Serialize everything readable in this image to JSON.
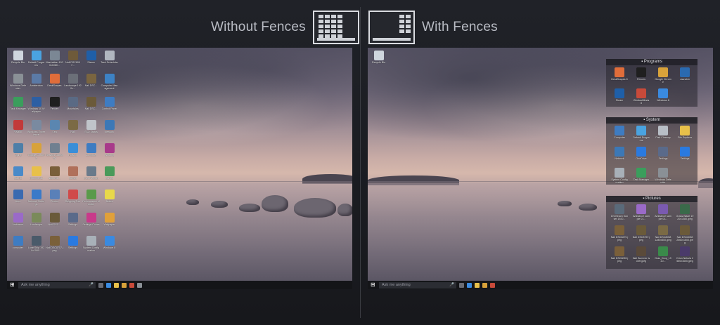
{
  "left": {
    "title": "Without Fences",
    "taskbar": {
      "search": "Ask me anything"
    },
    "icons": [
      {
        "label": "Recycle Bin",
        "color": "#cfd6de"
      },
      {
        "label": "Default Programs",
        "color": "#4aa3e0"
      },
      {
        "label": "Manhattan 1920x1080...",
        "color": "#7b8794"
      },
      {
        "label": "Nail DSC8097...",
        "color": "#6e5a3a"
      },
      {
        "label": "Steam",
        "color": "#1f5fa8"
      },
      {
        "label": "Task Scheduler",
        "color": "#b0b6bf"
      },
      {
        "label": "Windows Defender",
        "color": "#8a9096"
      },
      {
        "label": "Amsterdam",
        "color": "#5b7aa6"
      },
      {
        "label": "DeskScapes",
        "color": "#e06d3a"
      },
      {
        "label": "Landscape 1920x...",
        "color": "#6b6f78"
      },
      {
        "label": "Nail DSC...",
        "color": "#7a6540"
      },
      {
        "label": "Computer Management",
        "color": "#3d82c4"
      },
      {
        "label": "Task Manager",
        "color": "#3a9e5c"
      },
      {
        "label": "Windows 10 Wallpaper",
        "color": "#2d5fa3"
      },
      {
        "label": "Fences",
        "color": "#1f1f1f"
      },
      {
        "label": "Mountains",
        "color": "#5a6a84"
      },
      {
        "label": "Nail DSC...",
        "color": "#6b5a3a"
      },
      {
        "label": "Control Panel",
        "color": "#3e7cc2"
      },
      {
        "label": "Vivaldi",
        "color": "#c23a3a"
      },
      {
        "label": "Windows Experience",
        "color": "#7a8aa0"
      },
      {
        "label": "Sea",
        "color": "#5b86b0"
      },
      {
        "label": "Nail",
        "color": "#7b6a45"
      },
      {
        "label": "SSD Status",
        "color": "#c0c4ca"
      },
      {
        "label": "Network",
        "color": "#3c78b6"
      },
      {
        "label": "Alpine",
        "color": "#4d7fa8"
      },
      {
        "label": "Google Chrome",
        "color": "#d8a23a"
      },
      {
        "label": "Network Gateway",
        "color": "#708090"
      },
      {
        "label": "Hotspot",
        "color": "#3a8ed8"
      },
      {
        "label": "Computer",
        "color": "#3e7cc2"
      },
      {
        "label": "Winamp",
        "color": "#a83a8a"
      },
      {
        "label": "Start10",
        "color": "#4a8ac8"
      },
      {
        "label": "Documents",
        "color": "#e8c04a"
      },
      {
        "label": "Nail DSC...",
        "color": "#7a5f3a"
      },
      {
        "label": "Sunset",
        "color": "#b0705a"
      },
      {
        "label": "Event Viewer",
        "color": "#6a7a8a"
      },
      {
        "label": "Games",
        "color": "#4a9a5a"
      },
      {
        "label": "Aero",
        "color": "#3a6ab0"
      },
      {
        "label": "Network Settings",
        "color": "#3a7ac8"
      },
      {
        "label": "Photos",
        "color": "#5a80b8"
      },
      {
        "label": "Snipping Tool",
        "color": "#d04a4a"
      },
      {
        "label": "Performance Monitor",
        "color": "#5a9a4a"
      },
      {
        "label": "Notes",
        "color": "#e8d84a"
      },
      {
        "label": "Ambiance",
        "color": "#9a6ac8"
      },
      {
        "label": "Landscape",
        "color": "#7a8a5a"
      },
      {
        "label": "Nail DSC...",
        "color": "#6a5a3a"
      },
      {
        "label": "Settings",
        "color": "#5a6a8a"
      },
      {
        "label": "Settings Colors",
        "color": "#c83a8a"
      },
      {
        "label": "Wallpaper",
        "color": "#e0a03a"
      },
      {
        "label": "computer",
        "color": "#3e7cc2"
      },
      {
        "label": "Lone Ship 1920x1080...",
        "color": "#4a5a6a"
      },
      {
        "label": "Nail DSC8757.jpeg",
        "color": "#7a603a"
      },
      {
        "label": "Settings",
        "color": "#2a7ae0"
      },
      {
        "label": "System Configuration",
        "color": "#a8b0b8"
      },
      {
        "label": "Windows 8",
        "color": "#3a8ae0"
      }
    ]
  },
  "right": {
    "title": "With Fences",
    "taskbar": {
      "search": "Ask me anything"
    },
    "recycle": {
      "label": "Recycle Bin"
    },
    "fences": [
      {
        "name": "Programs",
        "items": [
          {
            "label": "DeskScapes 8",
            "color": "#e06d3a"
          },
          {
            "label": "Fences",
            "color": "#1f1f1f"
          },
          {
            "label": "Google Chrome",
            "color": "#d8a23a"
          },
          {
            "label": "Launcher",
            "color": "#2a6ab0"
          },
          {
            "label": "Steam",
            "color": "#1f5fa8"
          },
          {
            "label": "WindowBlinds 8",
            "color": "#c84a3a"
          },
          {
            "label": "Windows 8",
            "color": "#3a8ae0"
          }
        ]
      },
      {
        "name": "System",
        "items": [
          {
            "label": "Computer",
            "color": "#3e7cc2"
          },
          {
            "label": "Default Programs",
            "color": "#4aa3e0"
          },
          {
            "label": "Disk Cleanup",
            "color": "#b8bec6"
          },
          {
            "label": "File Explorer",
            "color": "#e8c04a"
          },
          {
            "label": "Network",
            "color": "#3c78b6"
          },
          {
            "label": "OneDrive",
            "color": "#2a7ae0"
          },
          {
            "label": "Settings",
            "color": "#5a6a8a"
          },
          {
            "label": "Settings",
            "color": "#2a7ae0"
          },
          {
            "label": "System Configuration",
            "color": "#a8b0b8"
          },
          {
            "label": "Task Manager",
            "color": "#3a9e5c"
          },
          {
            "label": "Windows Defender",
            "color": "#8a9096"
          }
        ]
      },
      {
        "name": "Pictures",
        "items": [
          {
            "label": "Dhi Beach Sunset 1920...",
            "color": "#5a6a7a"
          },
          {
            "label": "Ambiance sample 01...",
            "color": "#9a6ac8"
          },
          {
            "label": "Ambiance sample 03...",
            "color": "#7a5ab0"
          },
          {
            "label": "Grass Blade 1920x1080.jpeg",
            "color": "#3a6a4a"
          },
          {
            "label": "Nail DSC8270.jpeg",
            "color": "#7a603a"
          },
          {
            "label": "Nail DSC8757.jpeg",
            "color": "#6a5a3a"
          },
          {
            "label": "Nail DSC8058 1280x800.jpeg",
            "color": "#7a6a45"
          },
          {
            "label": "Nail DSC8058 2560x1600.jpeg",
            "color": "#6b5a3a"
          },
          {
            "label": "Nail DSC8059.jpeg",
            "color": "#7a5f3a"
          },
          {
            "label": "Nail Summer is over.jpeg",
            "color": "#5a4a3a"
          },
          {
            "label": "Gras_Drop_1920...",
            "color": "#3a8a4a"
          },
          {
            "label": "Orion Nebula 2560x1600.jpeg",
            "color": "#4a3a6a"
          }
        ]
      }
    ]
  }
}
